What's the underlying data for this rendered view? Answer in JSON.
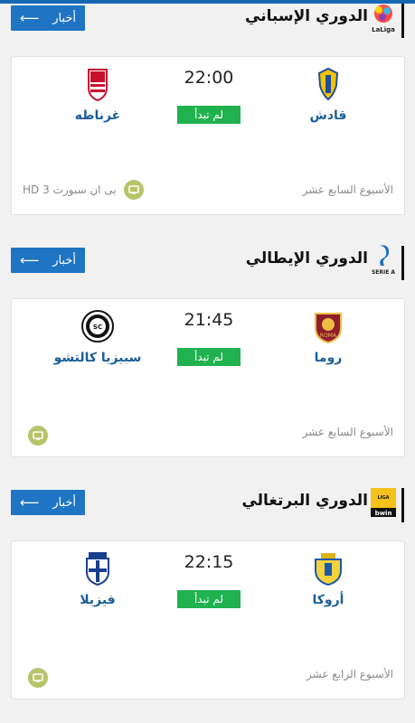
{
  "leagues": [
    {
      "name": "الدوري الإسباني",
      "logo_icon": "laliga-logo",
      "news_label": "أخبار",
      "match": {
        "home": "قادش",
        "away": "غرناطه",
        "time": "22:00",
        "status": "لم تبدأ",
        "round": "الأسبوع السابع عشر",
        "channel": "بى ان سبورت 3 HD"
      }
    },
    {
      "name": "الدوري الإيطالي",
      "logo_icon": "serie-a-logo",
      "news_label": "أخبار",
      "match": {
        "home": "روما",
        "away": "سبيزيا كالتشو",
        "time": "21:45",
        "status": "لم تبدأ",
        "round": "الأسبوع السابع عشر",
        "channel": ""
      }
    },
    {
      "name": "الدوري البرتغالي",
      "logo_icon": "liga-portugal-logo",
      "news_label": "أخبار",
      "match": {
        "home": "أروكا",
        "away": "فيزيلا",
        "time": "22:15",
        "status": "لم تبدأ",
        "round": "الأسبوع الرابع عشر",
        "channel": ""
      }
    }
  ],
  "colors": {
    "accent": "#1f74c4",
    "status_green": "#1fb24f",
    "team_text": "#1a5d99",
    "tv_icon": "#b8c46a"
  }
}
